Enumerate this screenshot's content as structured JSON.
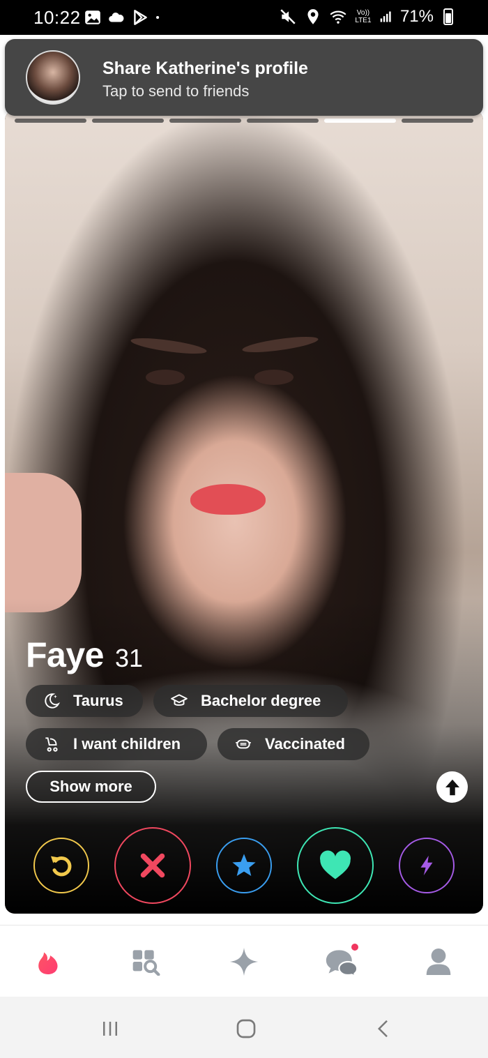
{
  "status_bar": {
    "time": "10:22",
    "signal_label": "Vo)) LTE1",
    "battery": "71%",
    "icons": [
      "gallery-icon",
      "cloud-icon",
      "play-store-icon",
      "dot-icon",
      "mute-icon",
      "location-icon",
      "wifi-icon",
      "signal-icon",
      "battery-icon"
    ]
  },
  "share_banner": {
    "title": "Share Katherine's profile",
    "subtitle": "Tap to send to friends"
  },
  "photo_progress": {
    "count": 6,
    "active_index": 4
  },
  "profile": {
    "name": "Faye",
    "age": "31",
    "chips": {
      "taurus": "Taurus",
      "degree": "Bachelor degree",
      "children": "I want children",
      "vaccinated": "Vaccinated"
    },
    "show_more": "Show more"
  },
  "actions": {
    "rewind_color": "#f2c94c",
    "nope_color": "#f0485f",
    "super_like_color": "#3a9ef0",
    "like_color": "#3ee6b4",
    "boost_color": "#a55be6"
  },
  "bottom_nav": {
    "items": [
      "flame-icon",
      "explore-icon",
      "sparkle-icon",
      "chat-icon",
      "profile-icon"
    ],
    "active": "flame-icon",
    "accent": "#fe3c72"
  },
  "system_nav": {
    "items": [
      "recents-icon",
      "home-icon",
      "back-icon"
    ]
  }
}
